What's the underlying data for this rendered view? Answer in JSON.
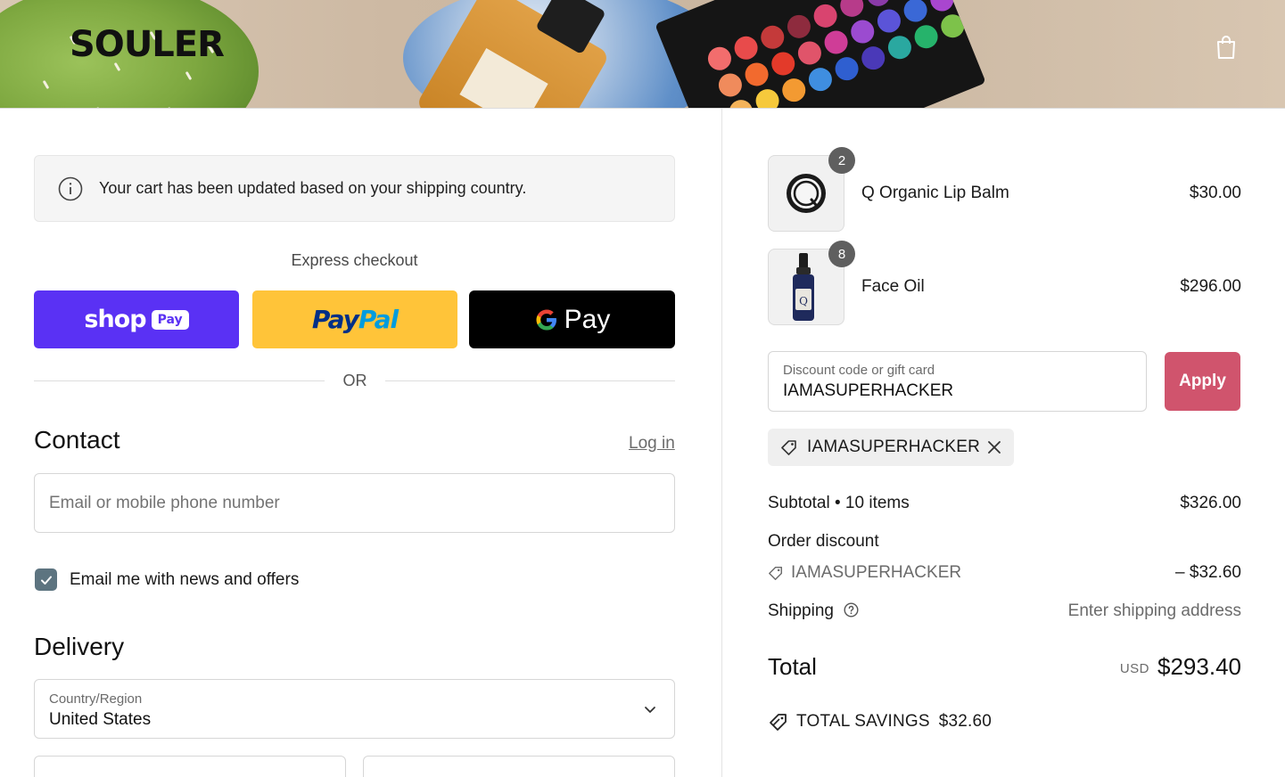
{
  "header": {
    "logo": "SOULER",
    "cart_icon": "shopping-bag-icon"
  },
  "notice": {
    "icon": "info-icon",
    "text": "Your cart has been updated based on your shipping country."
  },
  "express": {
    "title": "Express checkout",
    "shop_pay": {
      "word": "shop",
      "pill": "Pay",
      "color": "#5a31f4"
    },
    "paypal": {
      "word_a": "Pay",
      "word_b": "Pal",
      "color": "#ffc439"
    },
    "gpay": {
      "word": "Pay",
      "color": "#000000"
    },
    "or_text": "OR"
  },
  "contact": {
    "title": "Contact",
    "login_label": "Log in",
    "email_placeholder": "Email or mobile phone number",
    "newsletter_label": "Email me with news and offers",
    "newsletter_checked": true
  },
  "delivery": {
    "title": "Delivery",
    "country_label": "Country/Region",
    "country_value": "United States"
  },
  "cart": {
    "items": [
      {
        "name": "Q Organic Lip Balm",
        "price": "$30.00",
        "quantity": "2"
      },
      {
        "name": "Face Oil",
        "price": "$296.00",
        "quantity": "8"
      }
    ]
  },
  "discount": {
    "label": "Discount code or gift card",
    "value": "IAMASUPERHACKER",
    "apply_label": "Apply",
    "apply_color": "#d0546d",
    "applied_code": "IAMASUPERHACKER"
  },
  "summary": {
    "subtotal_label": "Subtotal • 10 items",
    "subtotal_value": "$326.00",
    "order_discount_label": "Order discount",
    "discount_code": "IAMASUPERHACKER",
    "discount_value": "– $32.60",
    "shipping_label": "Shipping",
    "shipping_value": "Enter shipping address",
    "total_label": "Total",
    "total_currency": "USD",
    "total_value": "$293.40",
    "savings_label": "TOTAL SAVINGS",
    "savings_value": "$32.60"
  }
}
